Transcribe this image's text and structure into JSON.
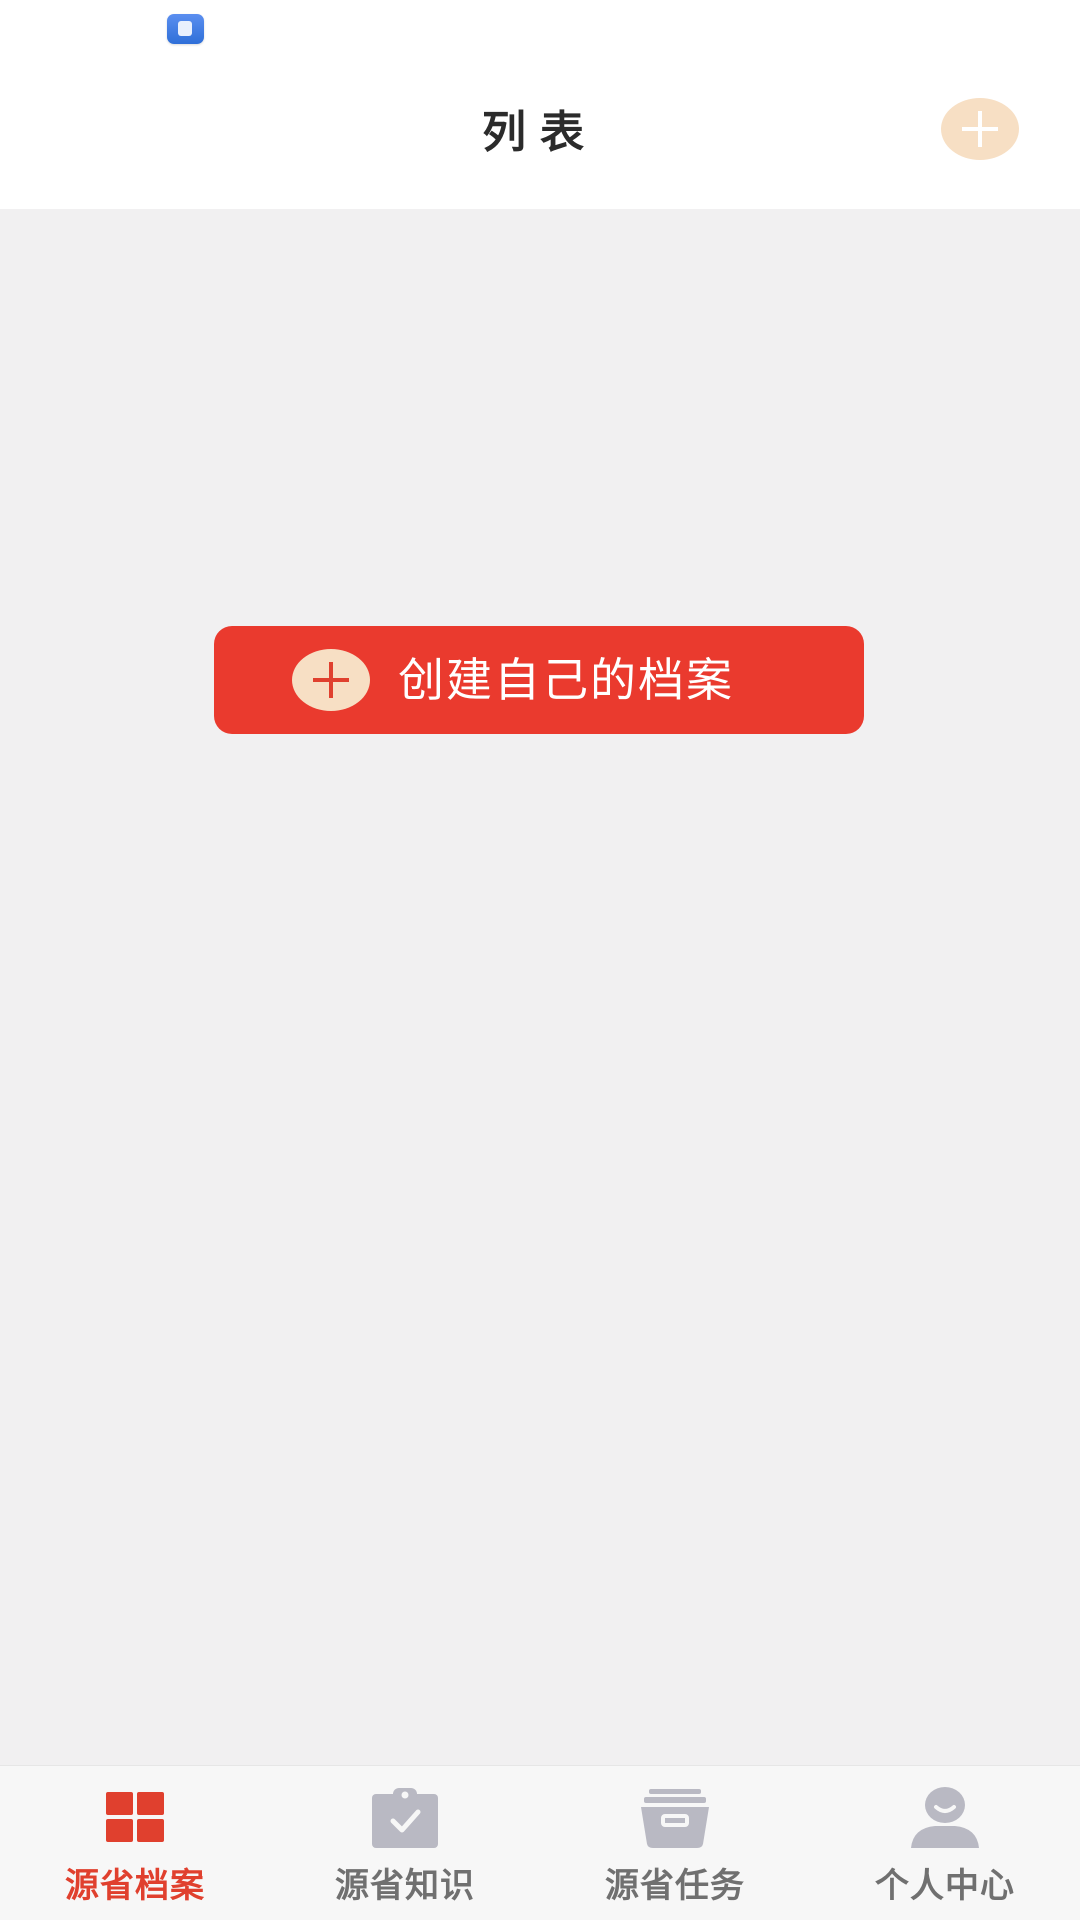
{
  "status_bar": {
    "app_icon": "app-notification-icon"
  },
  "header": {
    "title": "列表",
    "add_icon": "plus-icon"
  },
  "main": {
    "create_button_label": "创建自己的档案",
    "create_icon": "plus-icon"
  },
  "tab_bar": {
    "active_index": 0,
    "tabs": [
      {
        "label": "源省档案",
        "icon": "grid-icon",
        "active": true
      },
      {
        "label": "源省知识",
        "icon": "clipboard-check-icon",
        "active": false
      },
      {
        "label": "源省任务",
        "icon": "archive-box-icon",
        "active": false
      },
      {
        "label": "个人中心",
        "icon": "user-icon",
        "active": false
      }
    ]
  },
  "colors": {
    "accent_red": "#ea3a2e",
    "active_tab": "#e0402e",
    "inactive_tab": "#707070",
    "icon_grey": "#b9b9c3",
    "plus_badge": "#f7dfc4",
    "background": "#f1f0f1"
  }
}
